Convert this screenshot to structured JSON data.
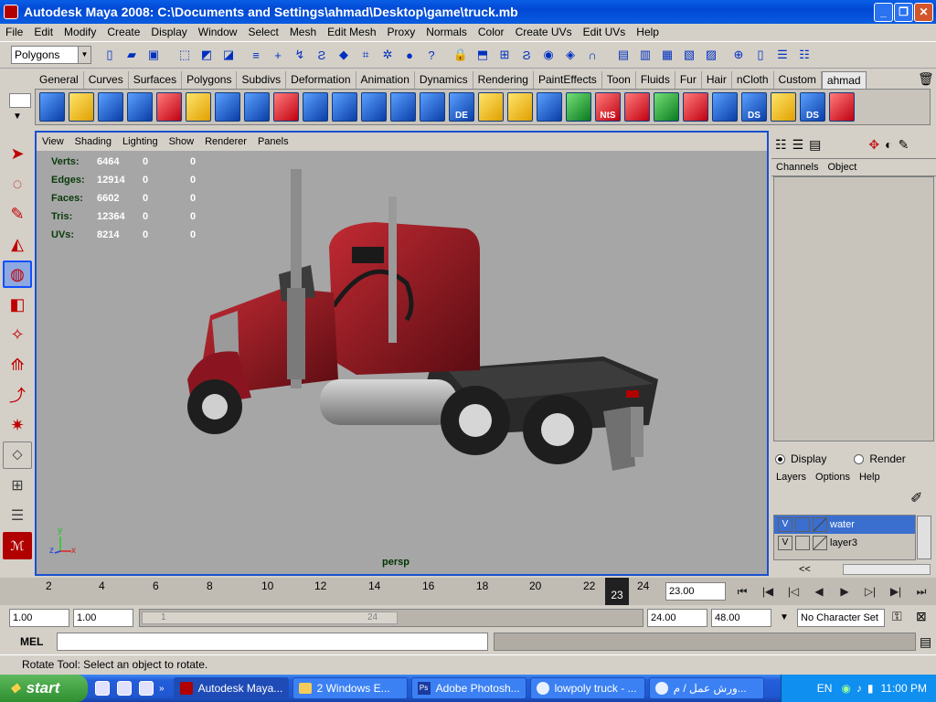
{
  "window": {
    "title": "Autodesk Maya 2008: C:\\Documents and Settings\\ahmad\\Desktop\\game\\truck.mb"
  },
  "menus": [
    "File",
    "Edit",
    "Modify",
    "Create",
    "Display",
    "Window",
    "Select",
    "Mesh",
    "Edit Mesh",
    "Proxy",
    "Normals",
    "Color",
    "Create UVs",
    "Edit UVs",
    "Help"
  ],
  "status_line": {
    "mode": "Polygons"
  },
  "shelf": {
    "tabs": [
      "General",
      "Curves",
      "Surfaces",
      "Polygons",
      "Subdivs",
      "Deformation",
      "Animation",
      "Dynamics",
      "Rendering",
      "PaintEffects",
      "Toon",
      "Fluids",
      "Fur",
      "Hair",
      "nCloth",
      "Custom",
      "ahmad"
    ],
    "active_tab": "ahmad",
    "icon_labels": [
      "DE",
      "NtS",
      "DS",
      "DS"
    ]
  },
  "viewport": {
    "menu": [
      "View",
      "Shading",
      "Lighting",
      "Show",
      "Renderer",
      "Panels"
    ],
    "hud": [
      {
        "label": "Verts:",
        "value": "6464",
        "sel": "0",
        "uv": "0"
      },
      {
        "label": "Edges:",
        "value": "12914",
        "sel": "0",
        "uv": "0"
      },
      {
        "label": "Faces:",
        "value": "6602",
        "sel": "0",
        "uv": "0"
      },
      {
        "label": "Tris:",
        "value": "12364",
        "sel": "0",
        "uv": "0"
      },
      {
        "label": "UVs:",
        "value": "8214",
        "sel": "0",
        "uv": "0"
      }
    ],
    "camera": "persp",
    "axes": {
      "x": "x",
      "y": "y",
      "z": "z"
    }
  },
  "channel_box": {
    "tabs": [
      "Channels",
      "Object"
    ]
  },
  "layer_editor": {
    "modes": [
      "Display",
      "Render"
    ],
    "selected_mode": "Display",
    "menu": [
      "Layers",
      "Options",
      "Help"
    ],
    "layers": [
      {
        "v": "V",
        "name": "water",
        "selected": true
      },
      {
        "v": "V",
        "name": "layer3",
        "selected": false
      }
    ],
    "scroll_label": "<<"
  },
  "time_slider": {
    "ticks": [
      "2",
      "4",
      "6",
      "8",
      "10",
      "12",
      "14",
      "16",
      "18",
      "20",
      "22",
      "24"
    ],
    "current_frame": "23",
    "current_time": "23.00"
  },
  "range_slider": {
    "start": "1.00",
    "playback_start": "1.00",
    "range_start_label": "1",
    "range_end_label": "24",
    "playback_end": "24.00",
    "end": "48.00",
    "character_set": "No Character Set"
  },
  "command_line": {
    "label": "MEL"
  },
  "help_line": {
    "text": "Rotate Tool: Select an object to rotate."
  },
  "taskbar": {
    "start": "start",
    "tasks": [
      {
        "label": "Autodesk Maya...",
        "active": true
      },
      {
        "label": "2 Windows E...",
        "active": false
      },
      {
        "label": "Adobe Photosh...",
        "active": false
      },
      {
        "label": "lowpoly truck - ...",
        "active": false
      },
      {
        "label": "ورش عمل / م...",
        "active": false
      }
    ],
    "language": "EN",
    "clock": "11:00 PM"
  }
}
